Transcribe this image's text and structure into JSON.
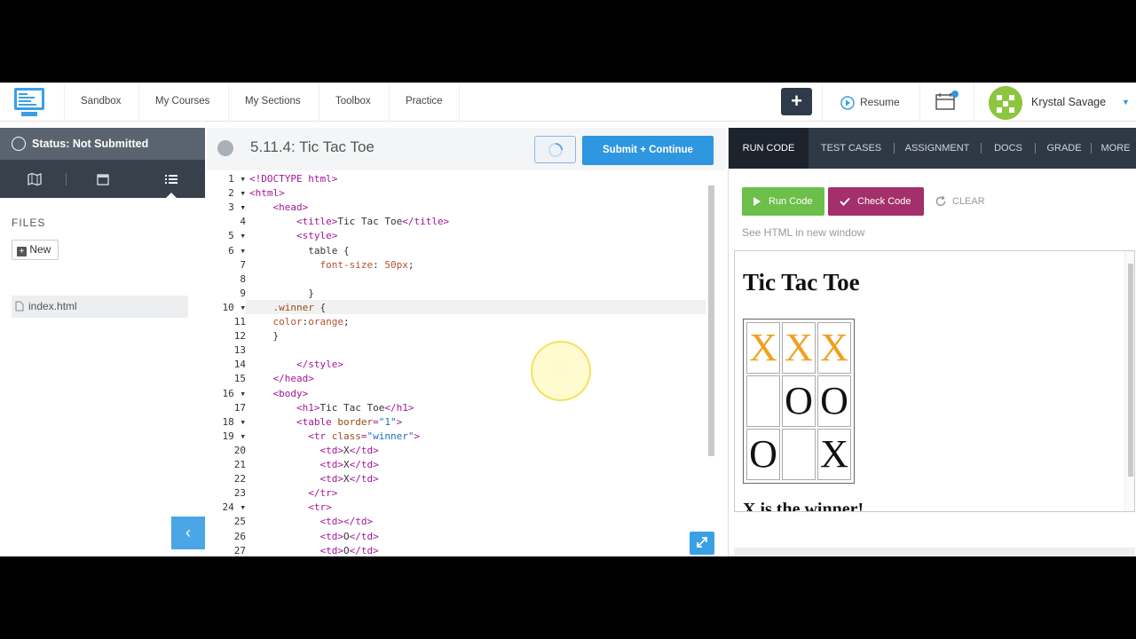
{
  "nav": {
    "links": [
      "Sandbox",
      "My Courses",
      "My Sections",
      "Toolbox",
      "Practice"
    ],
    "plus_label": "+",
    "resume_label": "Resume",
    "user_name": "Krystal Savage",
    "user_caret": "▼"
  },
  "sidebar": {
    "status": "Status: Not Submitted",
    "files_label": "FILES",
    "new_label": "New",
    "file_name": "index.html",
    "collapse_icon": "‹"
  },
  "editor": {
    "title": "5.11.4: Tic Tac Toe",
    "submit_label": "Submit + Continue",
    "active_line": 10
  },
  "right": {
    "tabs": [
      "RUN CODE",
      "TEST CASES",
      "ASSIGNMENT",
      "DOCS",
      "GRADE",
      "MORE"
    ],
    "run_label": "Run Code",
    "check_label": "Check Code",
    "clear_label": "CLEAR",
    "new_window": "See HTML in new window",
    "preview": {
      "heading": "Tic Tac Toe",
      "board": [
        [
          "X",
          "X",
          "X"
        ],
        [
          "",
          "O",
          "O"
        ],
        [
          "O",
          "",
          "X"
        ]
      ],
      "winner_text": "X is the winner!"
    }
  },
  "colors": {
    "accent_blue": "#2f96e0",
    "run_green": "#6cc04a",
    "check_purple": "#a3306a",
    "winner_orange": "#f0a020"
  }
}
